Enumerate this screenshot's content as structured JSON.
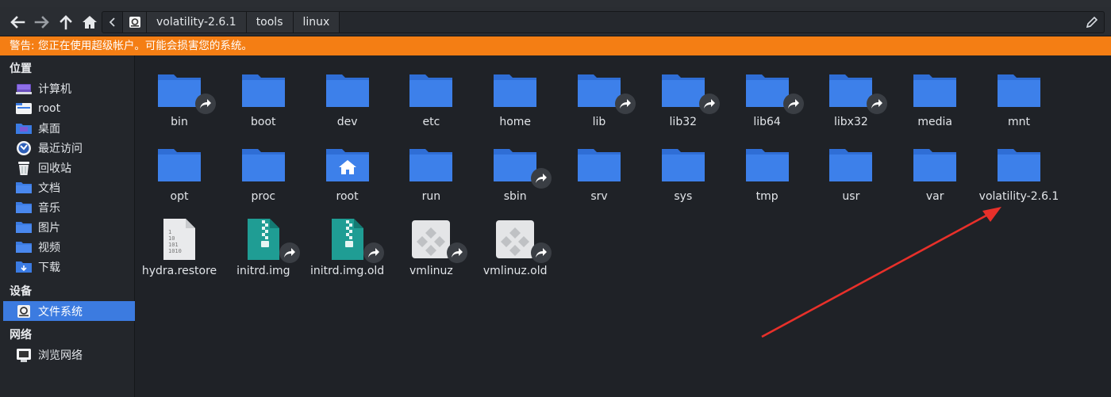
{
  "breadcrumbs": [
    "volatility-2.6.1",
    "tools",
    "linux"
  ],
  "warning": "警告: 您正在使用超级帐户。可能会损害您的系统。",
  "sidebar": {
    "places_title": "位置",
    "places": [
      {
        "label": "计算机",
        "icon": "computer-icon"
      },
      {
        "label": "root",
        "icon": "home-folder-icon"
      },
      {
        "label": "桌面",
        "icon": "desktop-folder-icon"
      },
      {
        "label": "最近访问",
        "icon": "recent-icon"
      },
      {
        "label": "回收站",
        "icon": "trash-icon"
      },
      {
        "label": "文档",
        "icon": "folder-icon"
      },
      {
        "label": "音乐",
        "icon": "folder-icon"
      },
      {
        "label": "图片",
        "icon": "folder-icon"
      },
      {
        "label": "视频",
        "icon": "folder-icon"
      },
      {
        "label": "下载",
        "icon": "download-folder-icon"
      }
    ],
    "devices_title": "设备",
    "devices": [
      {
        "label": "文件系统",
        "icon": "drive-icon"
      }
    ],
    "network_title": "网络",
    "network": [
      {
        "label": "浏览网络",
        "icon": "network-icon"
      }
    ]
  },
  "files": [
    {
      "name": "bin",
      "type": "folder",
      "link": true
    },
    {
      "name": "boot",
      "type": "folder",
      "link": false
    },
    {
      "name": "dev",
      "type": "folder",
      "link": false
    },
    {
      "name": "etc",
      "type": "folder",
      "link": false
    },
    {
      "name": "home",
      "type": "folder",
      "link": false
    },
    {
      "name": "lib",
      "type": "folder",
      "link": true
    },
    {
      "name": "lib32",
      "type": "folder",
      "link": true
    },
    {
      "name": "lib64",
      "type": "folder",
      "link": true
    },
    {
      "name": "libx32",
      "type": "folder",
      "link": true
    },
    {
      "name": "media",
      "type": "folder",
      "link": false
    },
    {
      "name": "mnt",
      "type": "folder",
      "link": false
    },
    {
      "name": "opt",
      "type": "folder",
      "link": false
    },
    {
      "name": "proc",
      "type": "folder",
      "link": false
    },
    {
      "name": "root",
      "type": "home",
      "link": false
    },
    {
      "name": "run",
      "type": "folder",
      "link": false
    },
    {
      "name": "sbin",
      "type": "folder",
      "link": true
    },
    {
      "name": "srv",
      "type": "folder",
      "link": false
    },
    {
      "name": "sys",
      "type": "folder",
      "link": false
    },
    {
      "name": "tmp",
      "type": "folder",
      "link": false
    },
    {
      "name": "usr",
      "type": "folder",
      "link": false
    },
    {
      "name": "var",
      "type": "folder",
      "link": false
    },
    {
      "name": "volatility-2.6.1",
      "type": "folder",
      "link": false
    },
    {
      "name": "hydra.restore",
      "type": "binary",
      "link": false
    },
    {
      "name": "initrd.img",
      "type": "archive",
      "link": true
    },
    {
      "name": "initrd.img.old",
      "type": "archive",
      "link": true
    },
    {
      "name": "vmlinuz",
      "type": "kernel",
      "link": true
    },
    {
      "name": "vmlinuz.old",
      "type": "kernel",
      "link": true
    }
  ],
  "colors": {
    "warning": "#f47e14",
    "folder": "#3b7be3",
    "selection": "#3c7be0",
    "annotation_arrow": "#e8302a"
  }
}
